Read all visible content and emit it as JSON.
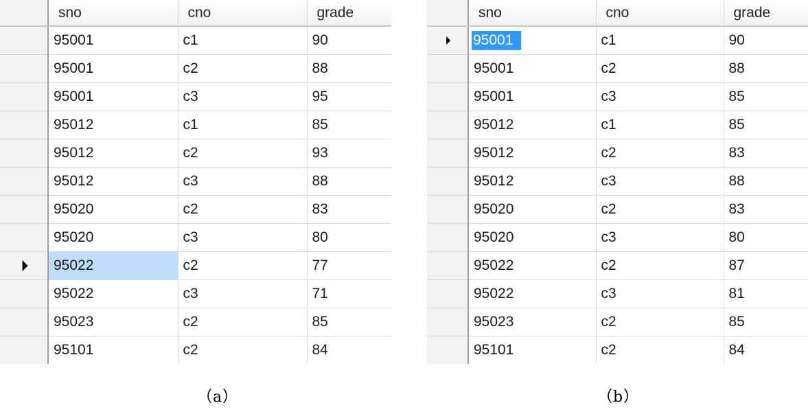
{
  "columns": [
    "sno",
    "cno",
    "grade"
  ],
  "table_a": {
    "caption": "（a）",
    "current_row": 8,
    "rows": [
      [
        "95001",
        "c1",
        "90"
      ],
      [
        "95001",
        "c2",
        "88"
      ],
      [
        "95001",
        "c3",
        "95"
      ],
      [
        "95012",
        "c1",
        "85"
      ],
      [
        "95012",
        "c2",
        "93"
      ],
      [
        "95012",
        "c3",
        "88"
      ],
      [
        "95020",
        "c2",
        "83"
      ],
      [
        "95020",
        "c3",
        "80"
      ],
      [
        "95022",
        "c2",
        "77"
      ],
      [
        "95022",
        "c3",
        "71"
      ],
      [
        "95023",
        "c2",
        "85"
      ],
      [
        "95101",
        "c2",
        "84"
      ]
    ]
  },
  "table_b": {
    "caption": "（b）",
    "current_row": 0,
    "rows": [
      [
        "95001",
        "c1",
        "90"
      ],
      [
        "95001",
        "c2",
        "88"
      ],
      [
        "95001",
        "c3",
        "85"
      ],
      [
        "95012",
        "c1",
        "85"
      ],
      [
        "95012",
        "c2",
        "83"
      ],
      [
        "95012",
        "c3",
        "88"
      ],
      [
        "95020",
        "c2",
        "83"
      ],
      [
        "95020",
        "c3",
        "80"
      ],
      [
        "95022",
        "c2",
        "87"
      ],
      [
        "95022",
        "c3",
        "81"
      ],
      [
        "95023",
        "c2",
        "85"
      ],
      [
        "95101",
        "c2",
        "84"
      ]
    ]
  },
  "colors": {
    "selection_light": "#bfdcfa",
    "selection_strong": "#3399ff",
    "gridline": "#d7d7d7",
    "header_bg": "#f2f2f2"
  }
}
